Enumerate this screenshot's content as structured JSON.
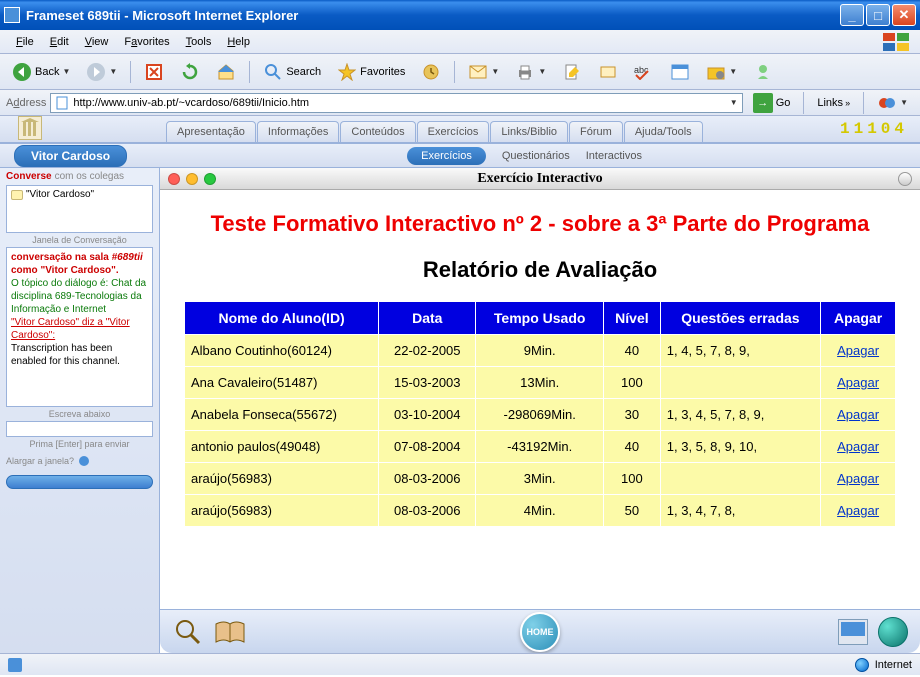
{
  "window": {
    "title": "Frameset 689tii - Microsoft Internet Explorer"
  },
  "menu": {
    "file": "File",
    "edit": "Edit",
    "view": "View",
    "favorites": "Favorites",
    "tools": "Tools",
    "help": "Help"
  },
  "toolbar": {
    "back": "Back",
    "search": "Search",
    "favorites": "Favorites"
  },
  "address": {
    "label": "Address",
    "url": "http://www.univ-ab.pt/~vcardoso/689tii/Inicio.htm",
    "go": "Go",
    "links": "Links"
  },
  "site": {
    "tabs": [
      "Apresentação",
      "Informações",
      "Conteúdos",
      "Exercícios",
      "Links/Biblio",
      "Fórum",
      "Ajuda/Tools"
    ],
    "counter": "11104",
    "user": "Vitor Cardoso",
    "sub_tabs": {
      "active": "Exercícios",
      "q": "Questionários",
      "i": "Interactivos"
    }
  },
  "sidebar": {
    "converse": "Converse",
    "converse_grey": "com os colegas",
    "msg1": "\"Vitor Cardoso\"",
    "janela": "Janela de Conversação",
    "chat_html": "<span class='red bold'>conversação na sala <i>#689tii</i> como \"Vitor Cardoso\".</span><br><span class='green'>O tópico do diálogo é: Chat da disciplina 689-Tecnologias da Informação e Internet</span><br><span class='red u'>\"Vitor Cardoso\" diz a \"Vitor Cardoso\":</span><br>Transcription has been enabled for this channel.",
    "escreva": "Escreva abaixo",
    "prima": "Prima [Enter] para enviar",
    "alargar": "Alargar a janela?"
  },
  "doc": {
    "mac_title": "Exercício Interactivo",
    "title": "Teste Formativo Interactivo nº 2 - sobre a 3ª Parte do Programa",
    "subtitle": "Relatório de Avaliação",
    "headers": [
      "Nome do Aluno(ID)",
      "Data",
      "Tempo Usado",
      "Nível",
      "Questões erradas",
      "Apagar"
    ],
    "apagar": "Apagar",
    "rows": [
      {
        "nome": "Albano Coutinho(60124)",
        "data": "22-02-2005",
        "tempo": "9Min.",
        "nivel": "40",
        "q": "1, 4, 5, 7, 8, 9,"
      },
      {
        "nome": "Ana Cavaleiro(51487)",
        "data": "15-03-2003",
        "tempo": "13Min.",
        "nivel": "100",
        "q": ""
      },
      {
        "nome": "Anabela Fonseca(55672)",
        "data": "03-10-2004",
        "tempo": "-298069Min.",
        "nivel": "30",
        "q": "1, 3, 4, 5, 7, 8, 9,"
      },
      {
        "nome": "antonio paulos(49048)",
        "data": "07-08-2004",
        "tempo": "-43192Min.",
        "nivel": "40",
        "q": "1, 3, 5, 8, 9, 10,"
      },
      {
        "nome": "araújo(56983)",
        "data": "08-03-2006",
        "tempo": "3Min.",
        "nivel": "100",
        "q": ""
      },
      {
        "nome": "araújo(56983)",
        "data": "08-03-2006",
        "tempo": "4Min.",
        "nivel": "50",
        "q": "1, 3, 4, 7, 8,"
      }
    ]
  },
  "bottom": {
    "home": "HOME"
  },
  "status": {
    "zone": "Internet"
  }
}
